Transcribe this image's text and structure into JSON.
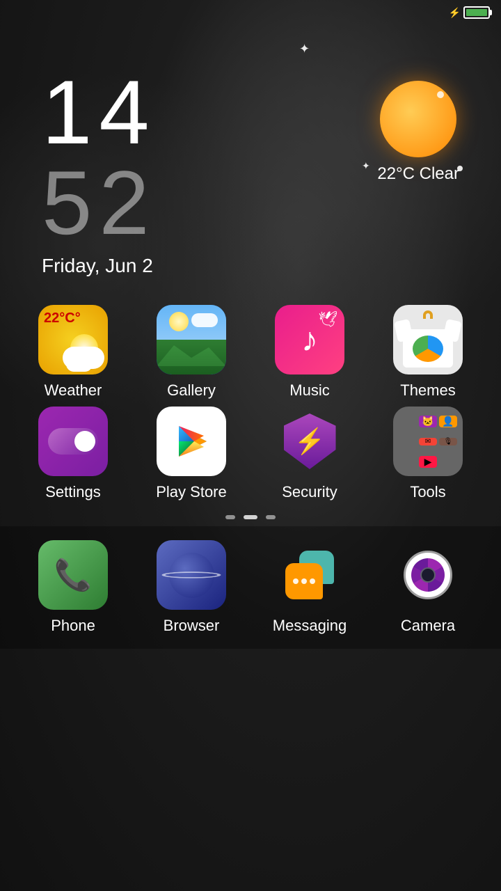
{
  "statusBar": {
    "batteryIcon": "⚡",
    "batteryPercent": 100
  },
  "clock": {
    "hours": "14",
    "minutes": "52",
    "date": "Friday, Jun 2"
  },
  "weather": {
    "temp": "22°C",
    "condition": "Clear",
    "displayTemp": "22°C Clear"
  },
  "weatherApp": {
    "temp": "22°C°"
  },
  "apps": {
    "row1": [
      {
        "id": "weather",
        "label": "Weather"
      },
      {
        "id": "gallery",
        "label": "Gallery"
      },
      {
        "id": "music",
        "label": "Music"
      },
      {
        "id": "themes",
        "label": "Themes"
      }
    ],
    "row2": [
      {
        "id": "settings",
        "label": "Settings"
      },
      {
        "id": "playstore",
        "label": "Play Store"
      },
      {
        "id": "security",
        "label": "Security"
      },
      {
        "id": "tools",
        "label": "Tools"
      }
    ],
    "dock": [
      {
        "id": "phone",
        "label": "Phone"
      },
      {
        "id": "browser",
        "label": "Browser"
      },
      {
        "id": "messaging",
        "label": "Messaging"
      },
      {
        "id": "camera",
        "label": "Camera"
      }
    ]
  },
  "pageIndicators": [
    {
      "active": false
    },
    {
      "active": true
    },
    {
      "active": false
    }
  ]
}
